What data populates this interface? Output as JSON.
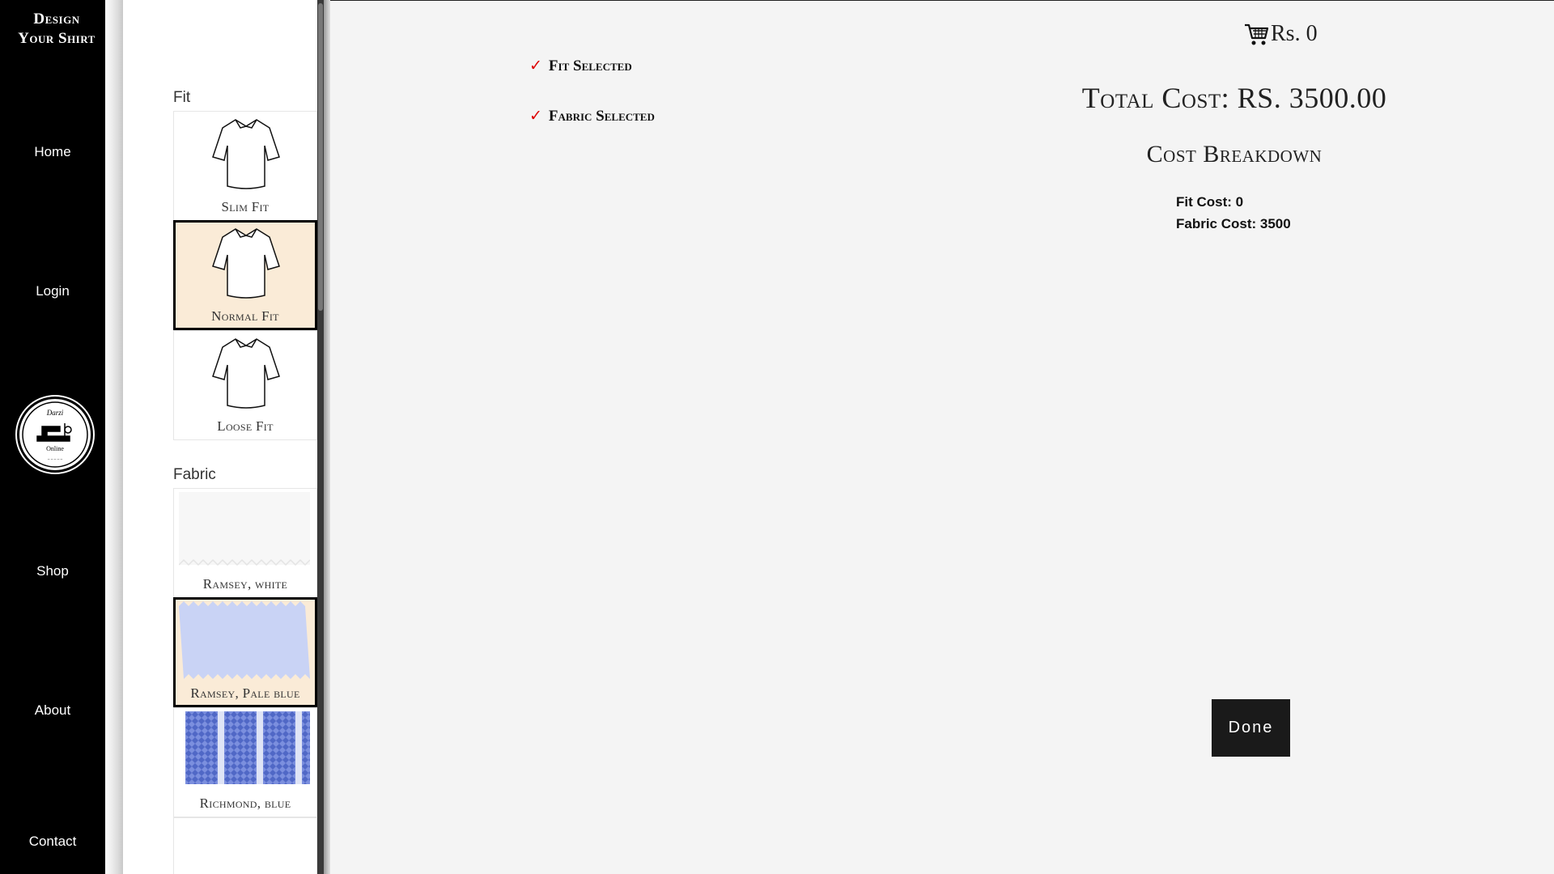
{
  "nav": {
    "brand_line1": "Design",
    "brand_line2": "Your Shirt",
    "items": [
      {
        "label": "Home"
      },
      {
        "label": "Login"
      },
      {
        "label": "Shop"
      },
      {
        "label": "About"
      },
      {
        "label": "Contact"
      }
    ],
    "logo_icon": "darzi-online-logo"
  },
  "panel": {
    "fit_label": "Fit",
    "fit_options": [
      {
        "label": "Slim Fit",
        "selected": false
      },
      {
        "label": "Normal Fit",
        "selected": true
      },
      {
        "label": "Loose Fit",
        "selected": false
      }
    ],
    "fabric_label": "Fabric",
    "fabric_options": [
      {
        "label": "Ramsey, white",
        "color": "#f7f7f7",
        "selected": false
      },
      {
        "label": "Ramsey, Pale blue",
        "color": "#c9d3f5",
        "selected": true
      },
      {
        "label": "Richmond, blue",
        "color": "#6f86d8",
        "selected": false
      }
    ]
  },
  "status": {
    "fit_selected": "Fit Selected",
    "fabric_selected": "Fabric Selected",
    "check_icon": "checkmark-icon"
  },
  "cart": {
    "amount": "Rs. 0",
    "icon": "cart-icon"
  },
  "summary": {
    "total": "Total Cost: RS. 3500.00",
    "breakdown_title": "Cost Breakdown",
    "fit_cost": "Fit Cost: 0",
    "fabric_cost": "Fabric Cost: 3500"
  },
  "actions": {
    "done_label": "Done"
  },
  "colors": {
    "accent_selected": "#faebd7",
    "check": "#dd0000",
    "button_bg": "#1a1a1a"
  }
}
